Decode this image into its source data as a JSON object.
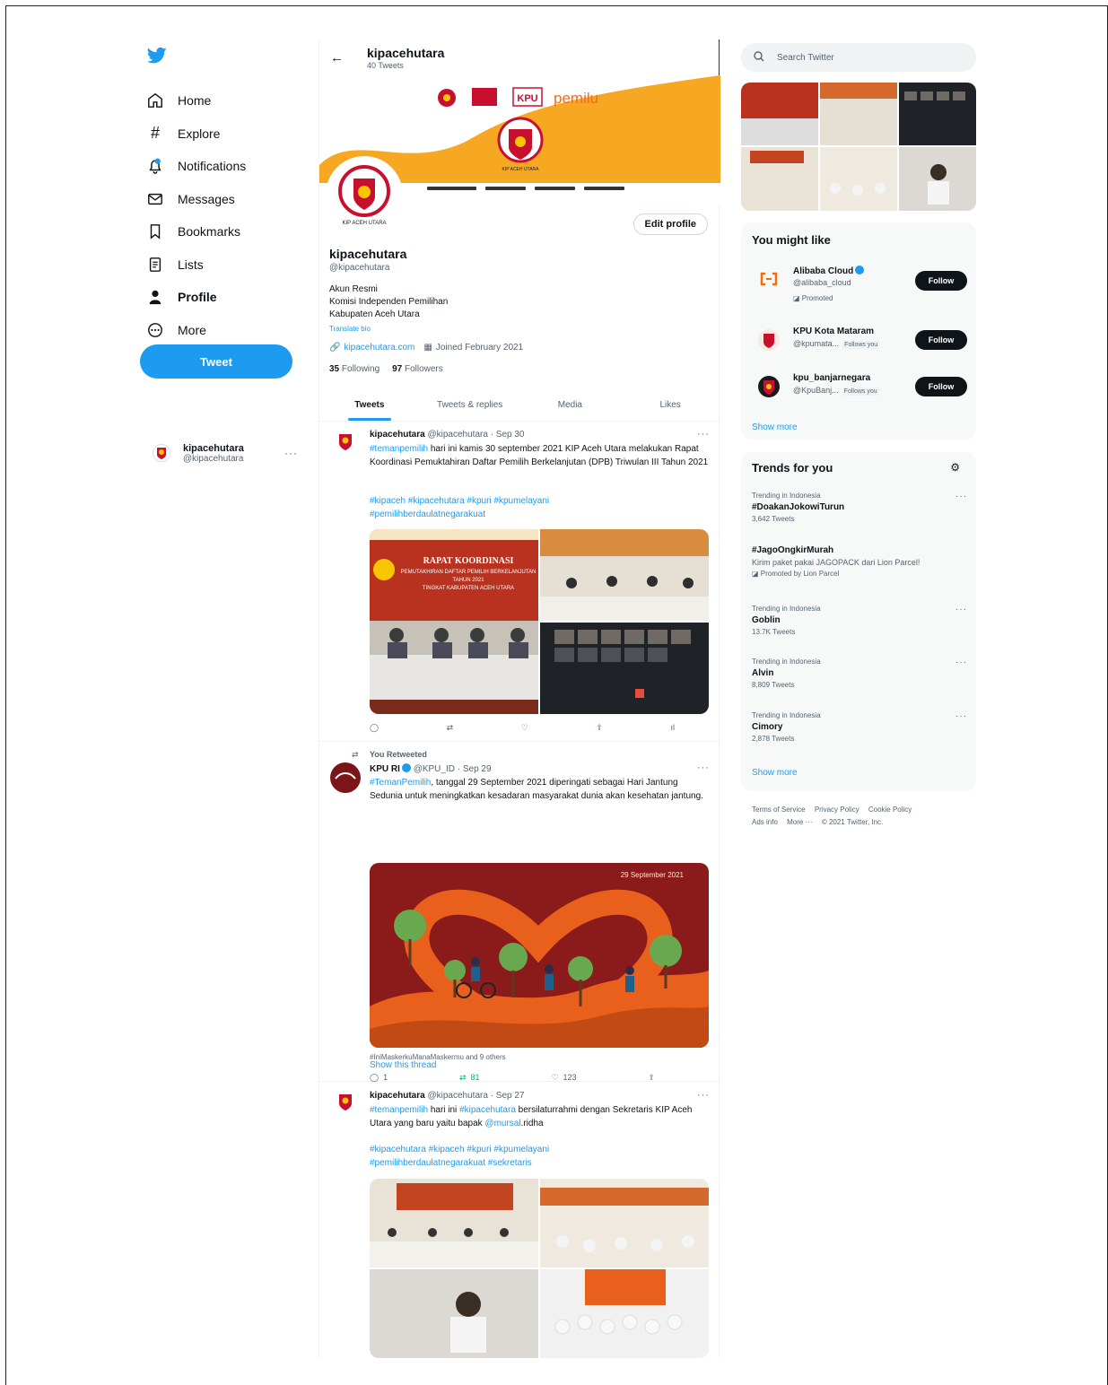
{
  "sidebar": {
    "nav": [
      {
        "icon": "home-icon",
        "label": "Home"
      },
      {
        "icon": "explore-icon",
        "label": "Explore"
      },
      {
        "icon": "notifications-icon",
        "label": "Notifications"
      },
      {
        "icon": "messages-icon",
        "label": "Messages"
      },
      {
        "icon": "bookmarks-icon",
        "label": "Bookmarks"
      },
      {
        "icon": "lists-icon",
        "label": "Lists"
      },
      {
        "icon": "profile-icon",
        "label": "Profile"
      },
      {
        "icon": "more-icon",
        "label": "More"
      }
    ],
    "tweet_button": "Tweet",
    "account": {
      "name": "kipacehutara",
      "handle": "@kipacehutara"
    }
  },
  "header": {
    "title": "kipacehutara",
    "subtitle": "40 Tweets"
  },
  "profile": {
    "edit_button": "Edit profile",
    "name": "kipacehutara",
    "handle": "@kipacehutara",
    "bio": [
      "Akun Resmi",
      "Komisi Independen Pemilihan",
      "Kabupaten Aceh Utara"
    ],
    "translate": "Translate bio",
    "website": "kipacehutara.com",
    "joined": "Joined February 2021",
    "following_count": "35",
    "following_label": "Following",
    "followers_count": "97",
    "followers_label": "Followers",
    "banner": {
      "org": "KIP ACEH UTARA",
      "kpu": "KPU",
      "pemilu": "pemilu"
    },
    "avatar_caption": "KIP ACEH UTARA"
  },
  "tabs": [
    "Tweets",
    "Tweets & replies",
    "Media",
    "Likes"
  ],
  "tweets": [
    {
      "name": "kipacehutara",
      "handle": "@kipacehutara",
      "date": "· Sep 30",
      "hashtag_lead": "#temanpemilih",
      "text": " hari ini kamis 30 september 2021 KIP Aceh Utara melakukan Rapat Koordinasi Pemuktahiran Daftar Pemilih Berkelanjutan (DPB) Triwulan III Tahun 2021",
      "tags": [
        "#kipaceh #kipacehutara #kpuri #kpumelayani",
        "#pemilihberdaulatnegarakuat"
      ],
      "banner_text": [
        "RAPAT KOORDINASI",
        "PEMUTAKHIRAN DAFTAR PEMILIH BERKELANJUTAN",
        "TAHUN 2021",
        "TINGKAT KABUPATEN ACEH UTARA"
      ]
    },
    {
      "retweet_label": "You Retweeted",
      "name": "KPU RI",
      "handle": "@KPU_ID",
      "date": "· Sep 29",
      "hashtag_lead": "#TemanPemilih",
      "text": ", tanggal 29 September 2021 diperingati sebagai Hari Jantung Sedunia untuk meningkatkan kesadaran masyarakat dunia akan kesehatan jantung.",
      "image_date": "29 September 2021",
      "caption": "#IniMaskerkuManaMaskermu and 9 others",
      "reply_count": "1",
      "retweet_count": "81",
      "like_count": "123",
      "show_thread": "Show this thread"
    },
    {
      "name": "kipacehutara",
      "handle": "@kipacehutara",
      "date": "· Sep 27",
      "hashtag_lead": "#temanpemilih",
      "text_a": " hari ini ",
      "hashtag_mid": "#kipacehutara",
      "text_b": " bersilaturrahmi dengan Sekretaris KIP Aceh Utara yang baru yaitu bapak ",
      "mention": "@mursal",
      "text_c": ".ridha",
      "tags": [
        "#kipacehutara #kipaceh #kpuri #kpumelayani",
        "#pemilihberdaulatnegarakuat #sekretaris"
      ]
    }
  ],
  "right": {
    "search_placeholder": "Search Twitter",
    "wtf_title": "You might like",
    "wtf": [
      {
        "name": "Alibaba Cloud",
        "handle": "@alibaba_cloud",
        "promoted": "Promoted",
        "button": "Follow"
      },
      {
        "name": "KPU Kota Mataram",
        "handle": "@kpumata...",
        "follows_you": "Follows you",
        "button": "Follow"
      },
      {
        "name": "kpu_banjarnegara",
        "handle": "@KpuBanj...",
        "follows_you": "Follows you",
        "button": "Follow"
      }
    ],
    "wtf_show_more": "Show more",
    "trends_title": "Trends for you",
    "trends": [
      {
        "context": "Trending in Indonesia",
        "title": "#DoakanJokowiTurun",
        "count": "3,642 Tweets"
      },
      {
        "context": "",
        "title": "#JagoOngkirMurah",
        "desc": "Kirim paket pakai JAGOPACK dari Lion Parcel!",
        "count": "Promoted by Lion Parcel"
      },
      {
        "context": "Trending in Indonesia",
        "title": "Goblin",
        "count": "13.7K Tweets"
      },
      {
        "context": "Trending in Indonesia",
        "title": "Alvin",
        "count": "8,809 Tweets"
      },
      {
        "context": "Trending in Indonesia",
        "title": "Cimory",
        "count": "2,878 Tweets"
      }
    ],
    "trends_show_more": "Show more",
    "footer": [
      "Terms of Service",
      "Privacy Policy",
      "Cookie Policy",
      "Ads info",
      "More ···",
      "© 2021 Twitter, Inc."
    ]
  },
  "colors": {
    "accent": "#1d9bf0",
    "banner_orange": "#f7a823",
    "kpu_red": "#c8102e",
    "heart_bg": "#8b1a1a",
    "heart_orange": "#e8601c"
  }
}
